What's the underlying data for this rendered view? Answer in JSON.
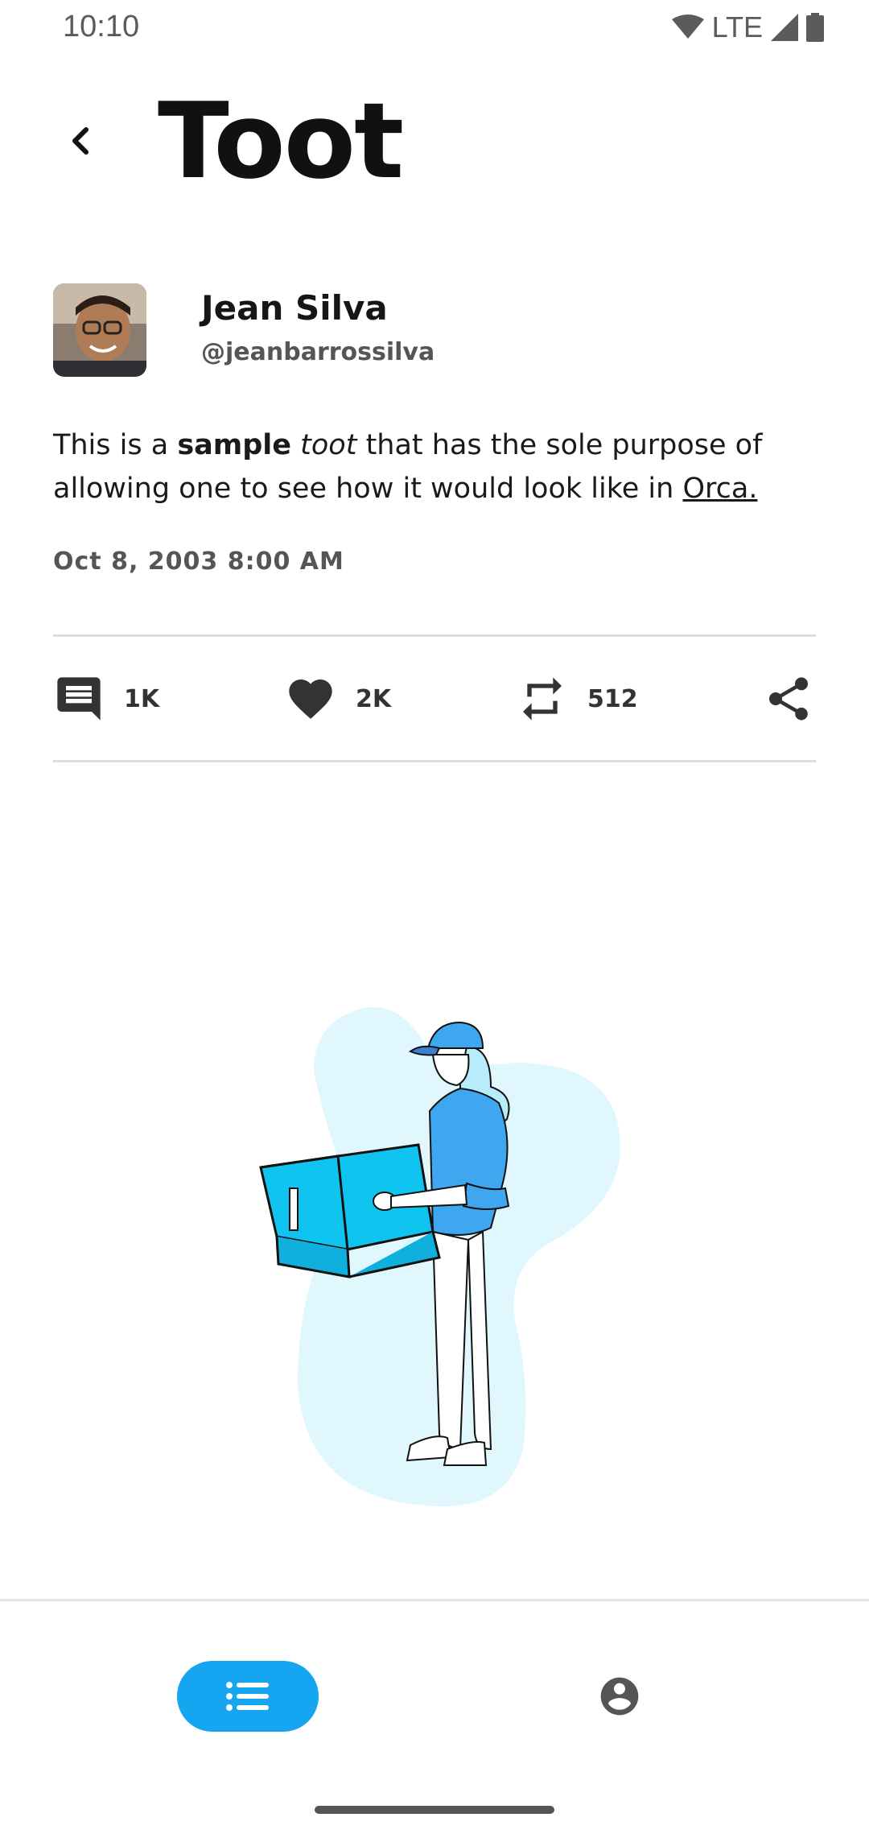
{
  "status": {
    "time": "10:10",
    "network": "LTE"
  },
  "header": {
    "title": "Toot"
  },
  "author": {
    "name": "Jean Silva",
    "handle": "@jeanbarrossilva"
  },
  "toot": {
    "text_prefix": "This is a ",
    "bold": "sample",
    "text_mid": " ",
    "italic": "toot",
    "text_suffix": " that has the sole purpose of allowing one to see how it would look like in ",
    "link": "Orca.",
    "timestamp": "Oct 8, 2003 8:00 AM"
  },
  "stats": {
    "comments": "1K",
    "likes": "2K",
    "reblogs": "512"
  },
  "icons": {
    "back": "back-arrow-icon",
    "comment": "comment-icon",
    "like": "heart-icon",
    "reblog": "repeat-icon",
    "share": "share-icon",
    "timeline": "list-icon",
    "profile": "account-circle-icon"
  },
  "colors": {
    "accent": "#16a5f0",
    "illustration_bg": "#e0f7fd"
  }
}
